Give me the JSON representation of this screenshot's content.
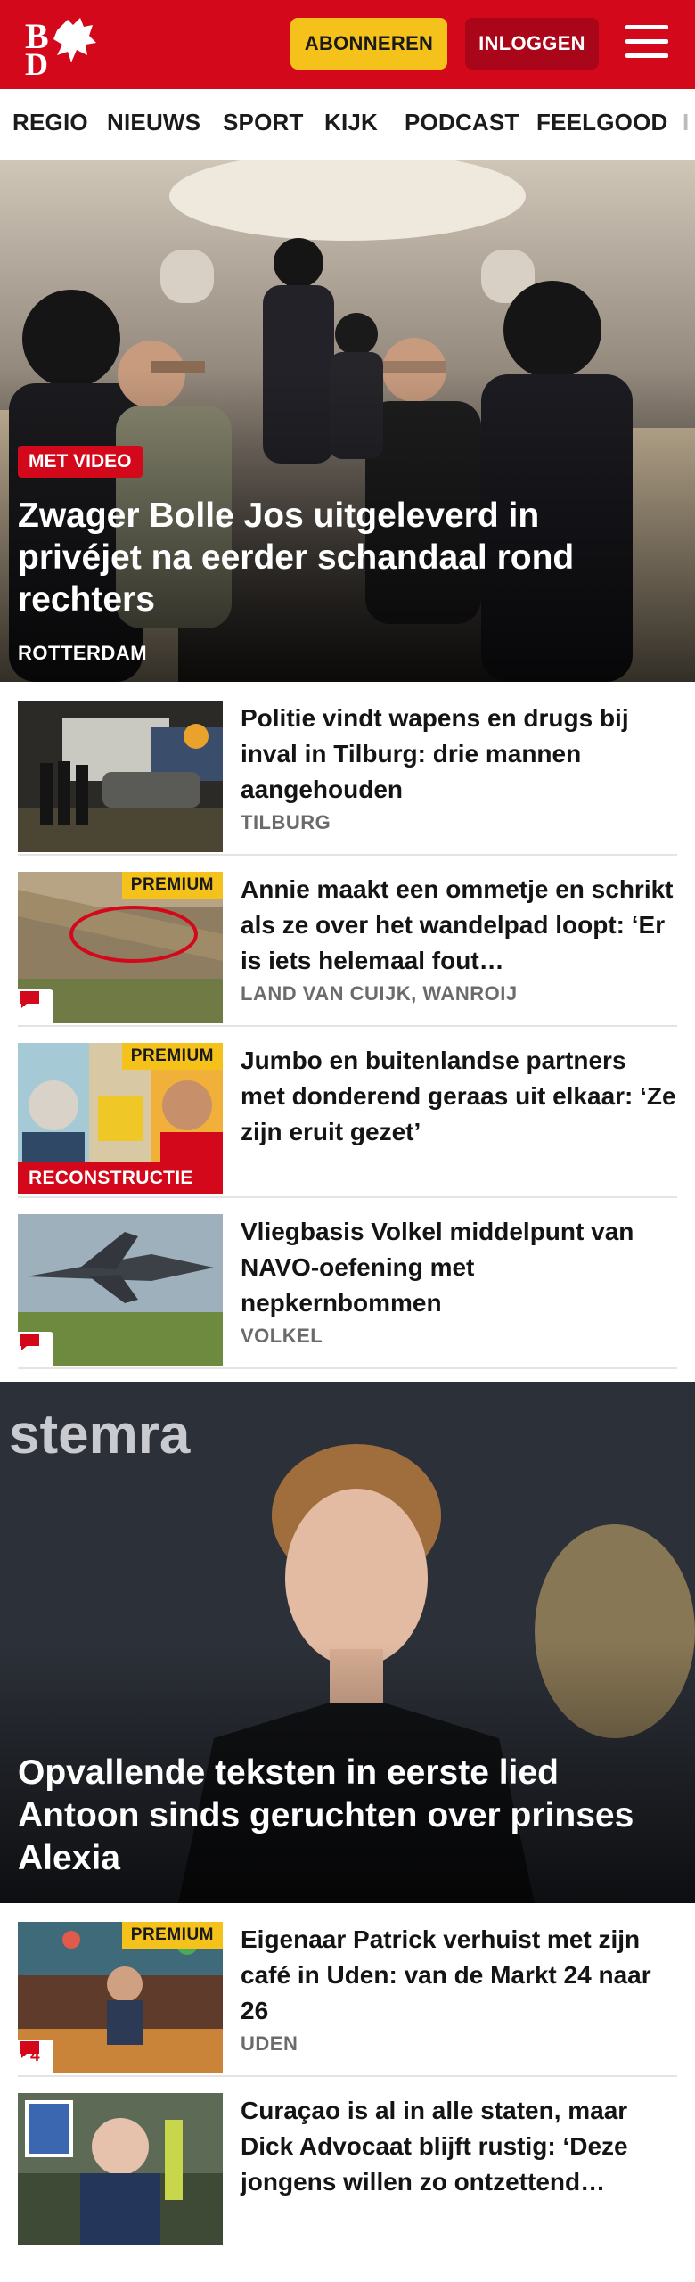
{
  "header": {
    "logo_text": "BD",
    "subscribe_label": "ABONNEREN",
    "login_label": "INLOGGEN",
    "brand_color": "#d3081a",
    "accent_color": "#f5c21b"
  },
  "nav": {
    "items": [
      "REGIO",
      "NIEUWS",
      "SPORT",
      "KIJK",
      "PODCAST",
      "FEELGOOD"
    ]
  },
  "hero": {
    "badge": "MET VIDEO",
    "title": "Zwager Bolle Jos uitgeleverd in privéjet na eerder schandaal rond rechters",
    "location": "ROTTERDAM"
  },
  "articles": [
    {
      "title": "Politie vindt wapens en drugs bij inval in Tilburg: drie mannen aangehouden",
      "location": "TILBURG"
    },
    {
      "title": "Annie maakt een ommetje en schrikt als ze over het wandelpad loopt: ‘Er is iets helemaal fout…",
      "location": "LAND VAN CUIJK, WANROIJ",
      "label": "PREMIUM"
    },
    {
      "title": "Jumbo en buitenlandse partners met donderend geraas uit elkaar: ‘Ze zijn eruit gezet’",
      "label": "PREMIUM",
      "tag": "RECONSTRUCTIE"
    },
    {
      "title": "Vliegbasis Volkel middelpunt van NAVO-oefening met nepkernbommen",
      "location": "VOLKEL"
    }
  ],
  "feature": {
    "title": "Opvallende teksten in eerste lied Antoon sinds geruchten over prinses Alexia",
    "background_text": "stemra"
  },
  "articles2": [
    {
      "title": "Eigenaar Patrick verhuist met zijn café in Uden: van de Markt 24 naar 26",
      "location": "UDEN",
      "label": "PREMIUM",
      "comments": "4"
    },
    {
      "title": "Curaçao is al in alle staten, maar Dick Advocaat blijft rustig: ‘Deze jongens willen zo ontzettend…"
    }
  ]
}
